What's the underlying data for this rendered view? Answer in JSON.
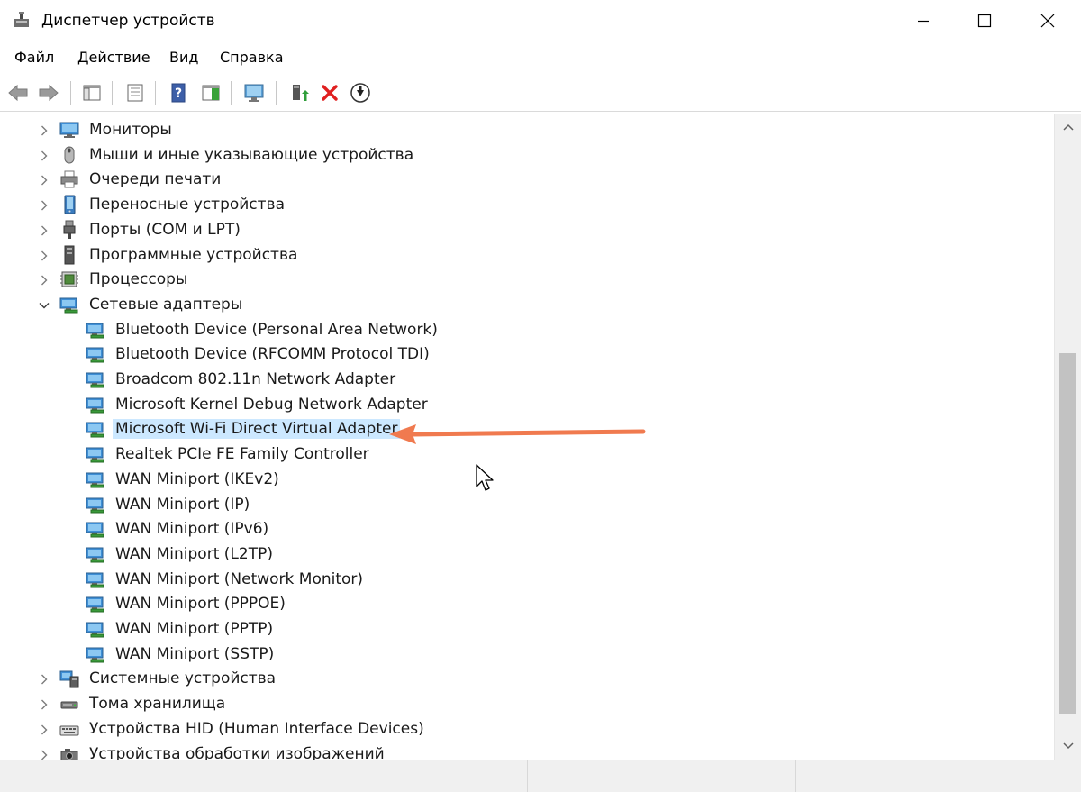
{
  "window": {
    "title": "Диспетчер устройств",
    "icons": {
      "app": "device-manager-icon",
      "minimize": "minimize-icon",
      "maximize": "maximize-icon",
      "close": "close-icon"
    }
  },
  "menu": {
    "items": [
      {
        "label": "Файл"
      },
      {
        "label": "Действие"
      },
      {
        "label": "Вид"
      },
      {
        "label": "Справка"
      }
    ]
  },
  "toolbar": {
    "buttons": [
      {
        "icon": "back-arrow-icon"
      },
      {
        "icon": "forward-arrow-icon"
      },
      {
        "icon": "show-hide-console-tree-icon"
      },
      {
        "icon": "properties-icon"
      },
      {
        "icon": "help-icon"
      },
      {
        "icon": "action-pane-icon"
      },
      {
        "icon": "scan-hardware-monitor-icon"
      },
      {
        "icon": "update-driver-icon"
      },
      {
        "icon": "uninstall-x-icon"
      },
      {
        "icon": "disable-device-icon"
      }
    ]
  },
  "tree": {
    "categories_top": [
      {
        "label": "Мониторы",
        "icon": "monitor-icon"
      },
      {
        "label": "Мыши и иные указывающие устройства",
        "icon": "mouse-icon"
      },
      {
        "label": "Очереди печати",
        "icon": "printer-icon"
      },
      {
        "label": "Переносные устройства",
        "icon": "portable-device-icon"
      },
      {
        "label": "Порты (COM и LPT)",
        "icon": "port-icon"
      },
      {
        "label": "Программные устройства",
        "icon": "software-device-icon"
      },
      {
        "label": "Процессоры",
        "icon": "processor-icon"
      }
    ],
    "network": {
      "label": "Сетевые адаптеры",
      "icon": "network-adapter-icon",
      "expanded": true,
      "children": [
        {
          "label": "Bluetooth Device (Personal Area Network)",
          "icon": "network-adapter-icon"
        },
        {
          "label": "Bluetooth Device (RFCOMM Protocol TDI)",
          "icon": "network-adapter-icon"
        },
        {
          "label": "Broadcom 802.11n Network Adapter",
          "icon": "network-adapter-icon"
        },
        {
          "label": "Microsoft Kernel Debug Network Adapter",
          "icon": "network-adapter-icon"
        },
        {
          "label": "Microsoft Wi-Fi Direct Virtual Adapter",
          "icon": "network-adapter-icon",
          "selected": true
        },
        {
          "label": "Realtek PCIe FE Family Controller",
          "icon": "network-adapter-icon"
        },
        {
          "label": "WAN Miniport (IKEv2)",
          "icon": "network-adapter-icon"
        },
        {
          "label": "WAN Miniport (IP)",
          "icon": "network-adapter-icon"
        },
        {
          "label": "WAN Miniport (IPv6)",
          "icon": "network-adapter-icon"
        },
        {
          "label": "WAN Miniport (L2TP)",
          "icon": "network-adapter-icon"
        },
        {
          "label": "WAN Miniport (Network Monitor)",
          "icon": "network-adapter-icon"
        },
        {
          "label": "WAN Miniport (PPPOE)",
          "icon": "network-adapter-icon"
        },
        {
          "label": "WAN Miniport (PPTP)",
          "icon": "network-adapter-icon"
        },
        {
          "label": "WAN Miniport (SSTP)",
          "icon": "network-adapter-icon"
        }
      ]
    },
    "categories_bottom": [
      {
        "label": "Системные устройства",
        "icon": "system-device-icon"
      },
      {
        "label": "Тома хранилища",
        "icon": "storage-volume-icon"
      },
      {
        "label": "Устройства HID (Human Interface Devices)",
        "icon": "hid-device-icon"
      },
      {
        "label": "Устройства обработки изображений",
        "icon": "imaging-device-icon"
      }
    ]
  },
  "colors": {
    "selection": "#cce8ff",
    "annotation_arrow": "#f07a4f"
  }
}
